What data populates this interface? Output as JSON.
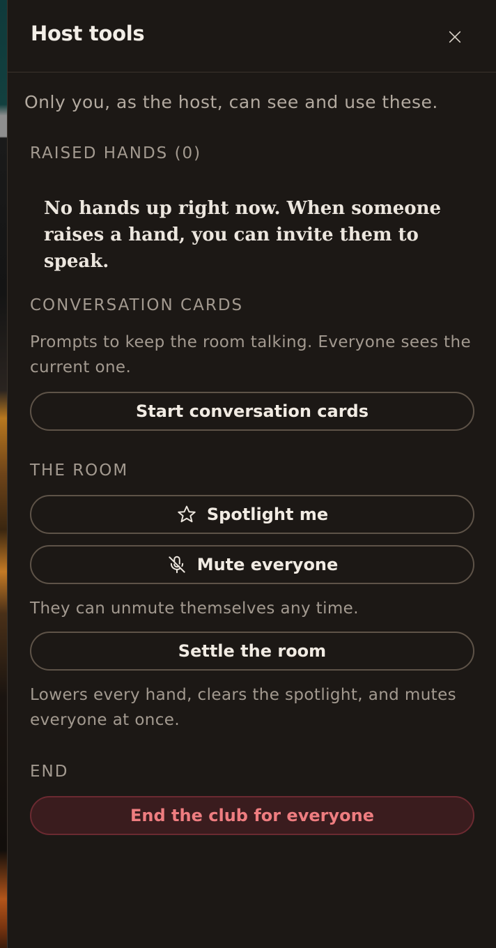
{
  "panel": {
    "title": "Host tools",
    "close_icon": "close-icon"
  },
  "intro": "Only you, as the host, can see and use these.",
  "raised_hands": {
    "heading": "RAISED HANDS (0)",
    "empty_message": "No hands up right now. When someone raises a hand, you can invite them to speak."
  },
  "conversation_cards": {
    "heading": "CONVERSATION CARDS",
    "description": "Prompts to keep the room talking. Everyone sees the current one.",
    "start_label": "Start conversation cards"
  },
  "room": {
    "heading": "THE ROOM",
    "spotlight_label": "Spotlight me",
    "spotlight_icon": "star-icon",
    "mute_label": "Mute everyone",
    "mute_icon": "mic-off-icon",
    "mute_note": "They can unmute themselves any time.",
    "settle_label": "Settle the room",
    "settle_note": "Lowers every hand, clears the spotlight, and mutes everyone at once."
  },
  "end": {
    "heading": "END",
    "end_label": "End the club for everyone"
  },
  "colors": {
    "panel_bg": "#1c1815",
    "text_primary": "#ece6de",
    "text_muted": "#a39a90",
    "button_border": "#5e5348",
    "danger_text": "#ee7d80",
    "danger_bg": "#3a1c1e"
  }
}
